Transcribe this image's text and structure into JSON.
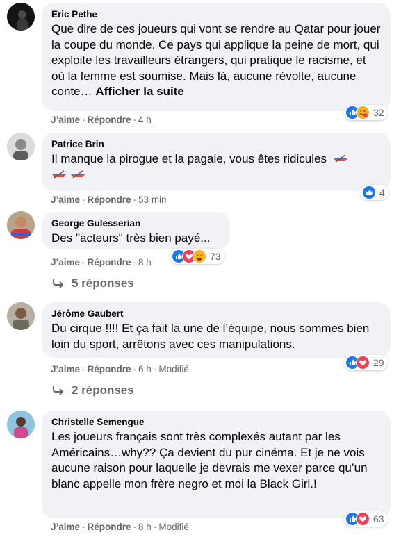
{
  "comments": [
    {
      "author": "Eric Pethe",
      "text": "Que dire de ces joueurs qui vont se rendre au Qatar pour jouer la coupe du monde. Ce pays qui applique la peine de mort, qui exploite les travailleurs étrangers, qui pratique le racisme, et où la femme est soumise. Mais là, aucune révolte, aucune conte…",
      "see_more": "Afficher la suite",
      "like": "J’aime",
      "reply": "Répondre",
      "time": "4 h",
      "reaction_count": "32"
    },
    {
      "author": "Patrice Brin",
      "text": "Il manque la pirogue et la pagaie, vous êtes ridicules",
      "like": "J’aime",
      "reply": "Répondre",
      "time": "53 min",
      "reaction_count": "4"
    },
    {
      "author": "George Gulesserian",
      "text": "Des \"acteurs\" très bien payé...",
      "like": "J’aime",
      "reply": "Répondre",
      "time": "8 h",
      "reaction_count": "73",
      "replies": "5 réponses"
    },
    {
      "author": "Jérôme Gaubert",
      "text": "Du cirque !!!! Et ça fait la une de l’équipe, nous sommes bien loin du sport, arrêtons avec ces manipulations.",
      "like": "J’aime",
      "reply": "Répondre",
      "time": "6 h",
      "edited": "Modifié",
      "reaction_count": "29",
      "replies": "2 réponses"
    },
    {
      "author": "Christelle Semengue",
      "text": "Les joueurs français sont très complexés autant par les Américains…why?? Ça devient du pur cinéma. Et je ne vois aucune raison pour laquelle je devrais me vexer parce qu’un blanc appelle mon frère negro et moi la Black Girl.!",
      "like": "J’aime",
      "reply": "Répondre",
      "time": "8 h",
      "edited": "Modifié",
      "reaction_count": "63"
    }
  ],
  "colors": {
    "bubble": "#f0f2f5",
    "meta": "#65676b",
    "like": "#1877f2",
    "love": "#f33e58",
    "haha": "#f7b125"
  }
}
